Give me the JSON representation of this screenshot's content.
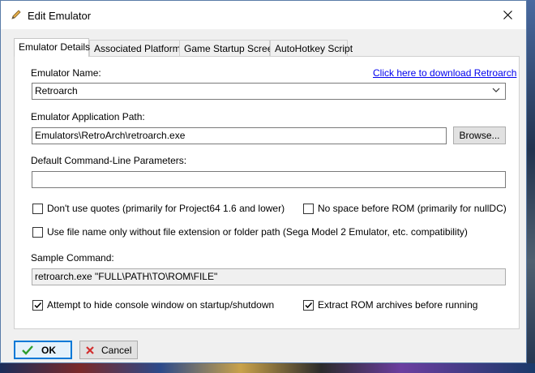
{
  "window": {
    "title": "Edit Emulator",
    "title_icon": "pencil-icon",
    "close_icon": "close-icon"
  },
  "tabs": [
    {
      "label": "Emulator Details",
      "active": true
    },
    {
      "label": "Associated Platforms",
      "active": false
    },
    {
      "label": "Game Startup Screen",
      "active": false
    },
    {
      "label": "AutoHotkey Script",
      "active": false
    }
  ],
  "form": {
    "emulator_name_label": "Emulator Name:",
    "download_link": "Click here to download Retroarch",
    "emulator_name_value": "Retroarch",
    "app_path_label": "Emulator Application Path:",
    "app_path_value": "Emulators\\RetroArch\\retroarch.exe",
    "browse_label": "Browse...",
    "cmdline_label": "Default Command-Line Parameters:",
    "cmdline_value": "",
    "sample_label": "Sample Command:",
    "sample_value": "retroarch.exe \"FULL\\PATH\\TO\\ROM\\FILE\""
  },
  "checkboxes": {
    "no_quotes": {
      "label": "Don't use quotes (primarily for Project64 1.6 and lower)",
      "checked": false
    },
    "no_space": {
      "label": "No space before ROM (primarily for nullDC)",
      "checked": false
    },
    "file_name_only": {
      "label": "Use file name only without file extension or folder path (Sega Model 2 Emulator, etc. compatibility)",
      "checked": false
    },
    "hide_console": {
      "label": "Attempt to hide console window on startup/shutdown",
      "checked": true
    },
    "extract_rom": {
      "label": "Extract ROM archives before running",
      "checked": true
    }
  },
  "footer": {
    "ok_label": "OK",
    "cancel_label": "Cancel",
    "ok_icon": "checkmark-icon",
    "cancel_icon": "x-icon"
  },
  "colors": {
    "accent": "#0078d7",
    "link": "#0000ee",
    "ok_check": "#2e9e2e",
    "cancel_x": "#d32f2f"
  }
}
